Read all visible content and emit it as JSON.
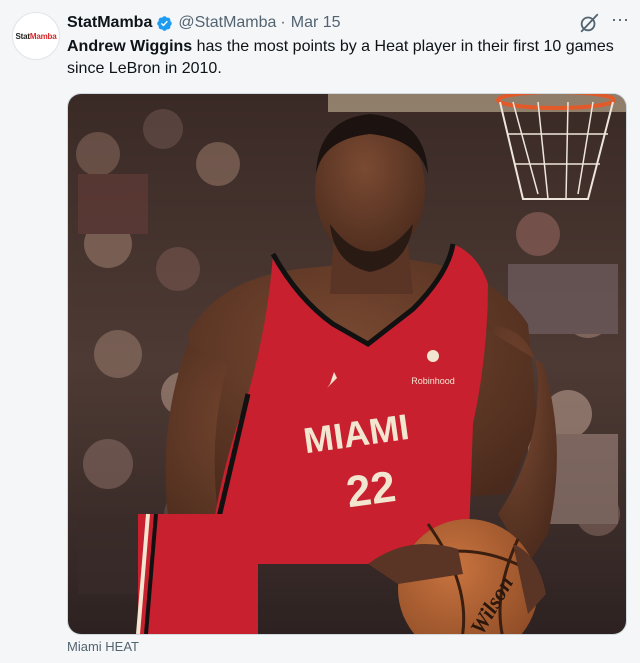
{
  "account": {
    "display_name": "StatMamba",
    "handle": "@StatMamba",
    "separator": "·",
    "date": "Mar 15",
    "avatar_text_1": "Stat",
    "avatar_text_2": "Mamba"
  },
  "tweet": {
    "highlight": "Andrew Wiggins",
    "text_rest": " has the most points by a Heat player in their first 10 games since LeBron in 2010."
  },
  "media": {
    "jersey_team": "MIAMI",
    "jersey_number": "22",
    "sponsor": "Robinhood",
    "ball_brand": "Wilson",
    "caption": "Miami HEAT"
  },
  "colors": {
    "verified": "#1d9bf0",
    "jersey": "#c8202f",
    "text_secondary": "#536471"
  },
  "icons": {
    "verified": "verified-badge-icon",
    "grok": "grok-icon",
    "more": "more-icon"
  }
}
